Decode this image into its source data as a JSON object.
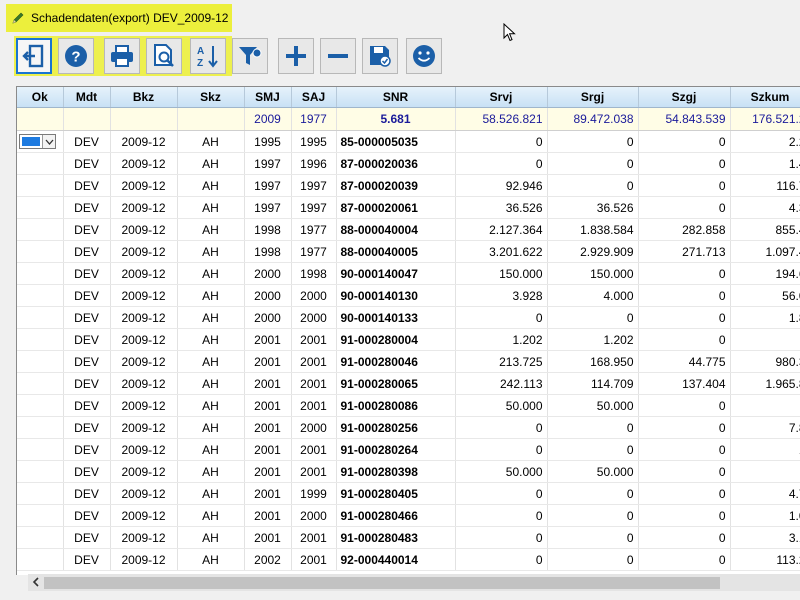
{
  "window": {
    "title": "Schadendaten(export) DEV_2009-12"
  },
  "toolbar": {
    "buttons": [
      {
        "name": "exit-button",
        "icon": "exit-icon"
      },
      {
        "name": "help-button",
        "icon": "question-icon"
      },
      {
        "name": "print-button",
        "icon": "printer-icon"
      },
      {
        "name": "preview-button",
        "icon": "print-preview-icon"
      },
      {
        "name": "sort-button",
        "icon": "sort-az-icon"
      },
      {
        "name": "filter-button",
        "icon": "filter-icon"
      },
      {
        "name": "add-button",
        "icon": "plus-icon"
      },
      {
        "name": "remove-button",
        "icon": "minus-icon"
      },
      {
        "name": "save-button",
        "icon": "save-icon"
      },
      {
        "name": "smiley-button",
        "icon": "smiley-icon"
      }
    ]
  },
  "grid": {
    "columns": [
      "Ok",
      "Mdt",
      "Bkz",
      "Skz",
      "SMJ",
      "SAJ",
      "SNR",
      "Srvj",
      "Srgj",
      "Szgj",
      "Szkum"
    ],
    "summary": [
      "",
      "",
      "",
      "",
      "2009",
      "1977",
      "5.681",
      "58.526.821",
      "89.472.038",
      "54.843.539",
      "176.521.2"
    ],
    "rows": [
      [
        "DEV",
        "2009-12",
        "AH",
        "1995",
        "1995",
        "85-000005035",
        "0",
        "0",
        "0",
        "2.2"
      ],
      [
        "DEV",
        "2009-12",
        "AH",
        "1997",
        "1996",
        "87-000020036",
        "0",
        "0",
        "0",
        "1.4"
      ],
      [
        "DEV",
        "2009-12",
        "AH",
        "1997",
        "1997",
        "87-000020039",
        "92.946",
        "0",
        "0",
        "116.7"
      ],
      [
        "DEV",
        "2009-12",
        "AH",
        "1997",
        "1997",
        "87-000020061",
        "36.526",
        "36.526",
        "0",
        "4.3"
      ],
      [
        "DEV",
        "2009-12",
        "AH",
        "1998",
        "1977",
        "88-000040004",
        "2.127.364",
        "1.838.584",
        "282.858",
        "855.4"
      ],
      [
        "DEV",
        "2009-12",
        "AH",
        "1998",
        "1977",
        "88-000040005",
        "3.201.622",
        "2.929.909",
        "271.713",
        "1.097.4"
      ],
      [
        "DEV",
        "2009-12",
        "AH",
        "2000",
        "1998",
        "90-000140047",
        "150.000",
        "150.000",
        "0",
        "194.6"
      ],
      [
        "DEV",
        "2009-12",
        "AH",
        "2000",
        "2000",
        "90-000140130",
        "3.928",
        "4.000",
        "0",
        "56.0"
      ],
      [
        "DEV",
        "2009-12",
        "AH",
        "2000",
        "2000",
        "90-000140133",
        "0",
        "0",
        "0",
        "1.8"
      ],
      [
        "DEV",
        "2009-12",
        "AH",
        "2001",
        "2001",
        "91-000280004",
        "1.202",
        "1.202",
        "0",
        ""
      ],
      [
        "DEV",
        "2009-12",
        "AH",
        "2001",
        "2001",
        "91-000280046",
        "213.725",
        "168.950",
        "44.775",
        "980.3"
      ],
      [
        "DEV",
        "2009-12",
        "AH",
        "2001",
        "2001",
        "91-000280065",
        "242.113",
        "114.709",
        "137.404",
        "1.965.8"
      ],
      [
        "DEV",
        "2009-12",
        "AH",
        "2001",
        "2001",
        "91-000280086",
        "50.000",
        "50.000",
        "0",
        ""
      ],
      [
        "DEV",
        "2009-12",
        "AH",
        "2001",
        "2000",
        "91-000280256",
        "0",
        "0",
        "0",
        "7.8"
      ],
      [
        "DEV",
        "2009-12",
        "AH",
        "2001",
        "2001",
        "91-000280264",
        "0",
        "0",
        "0",
        "1"
      ],
      [
        "DEV",
        "2009-12",
        "AH",
        "2001",
        "2001",
        "91-000280398",
        "50.000",
        "50.000",
        "0",
        ""
      ],
      [
        "DEV",
        "2009-12",
        "AH",
        "2001",
        "1999",
        "91-000280405",
        "0",
        "0",
        "0",
        "4.7"
      ],
      [
        "DEV",
        "2009-12",
        "AH",
        "2001",
        "2000",
        "91-000280466",
        "0",
        "0",
        "0",
        "1.0"
      ],
      [
        "DEV",
        "2009-12",
        "AH",
        "2001",
        "2001",
        "91-000280483",
        "0",
        "0",
        "0",
        "3.1"
      ],
      [
        "DEV",
        "2009-12",
        "AH",
        "2002",
        "2001",
        "92-000440014",
        "0",
        "0",
        "0",
        "113.2"
      ]
    ]
  },
  "colors": {
    "title_highlight": "#ecef3c",
    "header_gradient": "#c8e1f5",
    "summary_text": "#1a1a9a",
    "selection": "#1e7be0"
  }
}
